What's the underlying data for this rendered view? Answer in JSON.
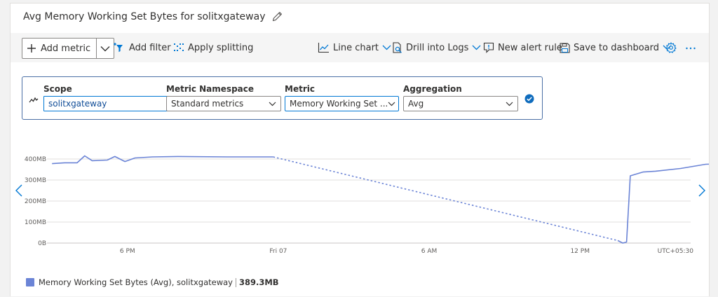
{
  "header": {
    "title": "Avg Memory Working Set Bytes for solitxgateway"
  },
  "toolbar": {
    "add_metric": "Add metric",
    "add_filter": "Add filter",
    "apply_splitting": "Apply splitting",
    "line_chart": "Line chart",
    "drill_into_logs": "Drill into Logs",
    "new_alert_rule": "New alert rule",
    "save_to_dashboard": "Save to dashboard"
  },
  "metric_row": {
    "scope": {
      "label": "Scope",
      "value": "solitxgateway"
    },
    "namespace": {
      "label": "Metric Namespace",
      "value": "Standard metrics"
    },
    "metric": {
      "label": "Metric",
      "value": "Memory Working Set ..."
    },
    "aggregation": {
      "label": "Aggregation",
      "value": "Avg"
    }
  },
  "chart_data": {
    "type": "line",
    "y_ticks": [
      "400MB",
      "300MB",
      "200MB",
      "100MB",
      "0B"
    ],
    "y_tick_values": [
      400,
      300,
      200,
      100,
      0
    ],
    "ylim": [
      0,
      400
    ],
    "y_unit": "MB",
    "x_ticks": [
      "6 PM",
      "Fri 07",
      "6 AM",
      "12 PM"
    ],
    "x_tick_hours": [
      18,
      24,
      30,
      36
    ],
    "timezone_label": "UTC+05:30",
    "xlim_hours": [
      14.8,
      40.4
    ],
    "grid": true,
    "series": [
      {
        "name": "Memory Working Set Bytes (Avg), solitxgateway",
        "color": "#6b84d6",
        "segments": [
          {
            "style": "solid",
            "x": [
              15.0,
              15.5,
              16.0,
              16.3,
              16.6,
              17.2,
              17.5,
              17.9,
              18.3,
              19.0,
              20.0,
              22.0,
              23.8
            ],
            "y": [
              378,
              382,
              382,
              415,
              392,
              395,
              412,
              388,
              405,
              410,
              412,
              410,
              410
            ]
          },
          {
            "style": "dotted",
            "x": [
              23.8,
              37.5
            ],
            "y": [
              410,
              12
            ]
          },
          {
            "style": "solid",
            "x": [
              37.5,
              37.7,
              37.85,
              38.0,
              38.5,
              39.0,
              40.0,
              41.0,
              42.0,
              43.0,
              44.0,
              44.8,
              45.5
            ],
            "y": [
              12,
              0,
              5,
              320,
              338,
              342,
              355,
              375,
              378,
              377,
              380,
              382,
              380
            ]
          }
        ]
      }
    ],
    "legend": {
      "placement": "bottom-left",
      "label": "Memory Working Set Bytes (Avg), solitxgateway",
      "value": "389.3MB"
    }
  },
  "colors": {
    "accent": "#0078d4",
    "series": "#6b84d6"
  }
}
